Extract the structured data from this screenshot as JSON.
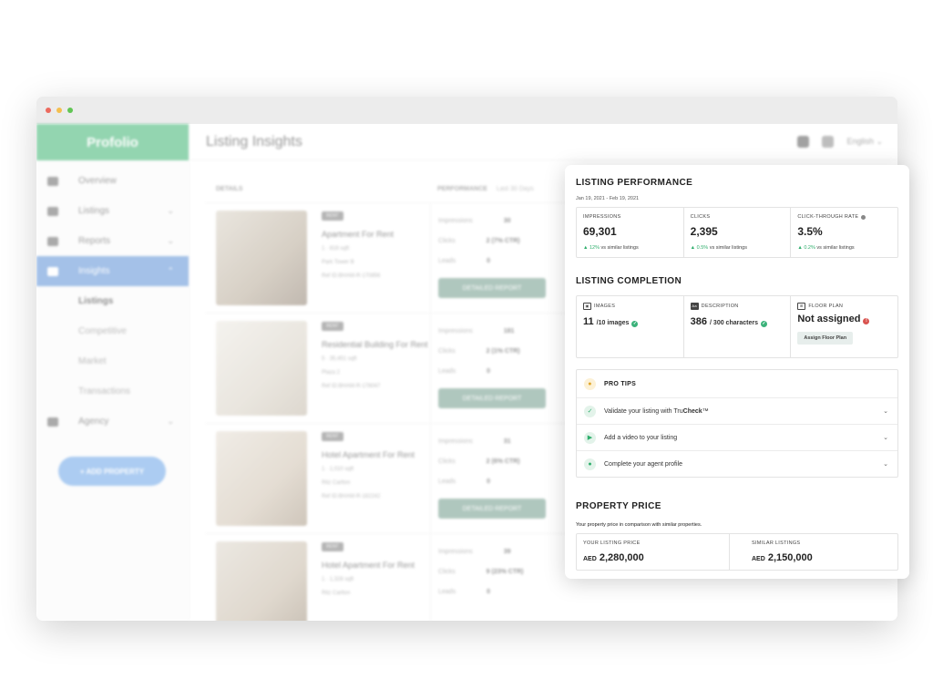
{
  "window": {
    "dots": [
      "#ec6a5e",
      "#f4bf4f",
      "#61c554"
    ]
  },
  "sidebar": {
    "brand": "Profolio",
    "items": [
      {
        "label": "Overview",
        "icon": "grid-icon"
      },
      {
        "label": "Listings",
        "icon": "list-icon",
        "chevron": "⌄"
      },
      {
        "label": "Reports",
        "icon": "bar-chart-icon",
        "chevron": "⌄"
      },
      {
        "label": "Insights",
        "icon": "insights-icon",
        "chevron": "⌃"
      }
    ],
    "insights_sub": [
      "Listings",
      "Competitive",
      "Market",
      "Transactions"
    ],
    "agency": {
      "label": "Agency",
      "icon": "people-icon",
      "chevron": "⌄"
    },
    "add_property": "+ ADD PROPERTY"
  },
  "header": {
    "title": "Listing Insights",
    "language": "English ⌄"
  },
  "table": {
    "details_head": "DETAILS",
    "performance_head": "PERFORMANCE",
    "range_select": "Last 30 Days",
    "report_label": "DETAILED REPORT",
    "rows": [
      {
        "tag": "RENT",
        "title": "Apartment For Rent",
        "beds": "1",
        "area": "818 sqft",
        "location": "Park Tower B",
        "ref": "Ref ID:BHAM-R-170856",
        "impressions": "30",
        "clicks": "2 (7% CTR)",
        "leads": "0"
      },
      {
        "tag": "RENT",
        "title": "Residential Building For Rent",
        "beds": "5",
        "area": "35,451 sqft",
        "location": "Plaza 2",
        "ref": "Ref ID:BHAM-R-178047",
        "impressions": "181",
        "clicks": "2 (1% CTR)",
        "leads": "0"
      },
      {
        "tag": "RENT",
        "title": "Hotel Apartment For Rent",
        "beds": "1",
        "area": "1,010 sqft",
        "location": "Ritz Carlton",
        "ref": "Ref ID:BHAM-R-182242",
        "impressions": "31",
        "clicks": "2 (6% CTR)",
        "leads": "0"
      },
      {
        "tag": "RENT",
        "title": "Hotel Apartment For Rent",
        "beds": "1",
        "area": "1,328 sqft",
        "location": "Ritz Carlton",
        "ref": "",
        "impressions": "39",
        "clicks": "9 (23% CTR)",
        "leads": "0"
      }
    ]
  },
  "performance": {
    "title": "LISTING PERFORMANCE",
    "date_range": "Jan 19, 2021 - Feb 19, 2021",
    "metrics": [
      {
        "label": "IMPRESSIONS",
        "value": "69,301",
        "delta": "12%",
        "delta_suffix": " vs similar listings"
      },
      {
        "label": "CLICKS",
        "value": "2,395",
        "delta": "0.5%",
        "delta_suffix": " vs similar listings"
      },
      {
        "label": "CLICK-THROUGH RATE",
        "value": "3.5%",
        "delta": "0.2%",
        "delta_suffix": " vs similar listings"
      }
    ],
    "accent": "#2eae6c"
  },
  "completion": {
    "title": "LISTING COMPLETION",
    "images": {
      "label": "IMAGES",
      "value": "11",
      "suffix": "/10 images"
    },
    "description": {
      "label": "DESCRIPTION",
      "value": "386",
      "suffix": "/ 300 characters"
    },
    "floor_plan": {
      "label": "FLOOR PLAN",
      "value": "Not assigned",
      "action": "Assign Floor Plan"
    }
  },
  "tips": {
    "title": "PRO TIPS",
    "items": [
      {
        "text_pre": "Validate your listing with Tru",
        "text_bold": "Check",
        "text_post": "™"
      },
      {
        "text_pre": "Add a video to your listing",
        "text_bold": "",
        "text_post": ""
      },
      {
        "text_pre": "Complete your agent profile",
        "text_bold": "",
        "text_post": ""
      }
    ]
  },
  "price": {
    "title": "PROPERTY PRICE",
    "subtitle": "Your property price in comparison with similar properties.",
    "yours": {
      "label": "YOUR LISTING PRICE",
      "currency": "AED",
      "value": "2,280,000"
    },
    "similar": {
      "label": "SIMILAR LISTINGS",
      "currency": "AED",
      "value": "2,150,000"
    }
  }
}
